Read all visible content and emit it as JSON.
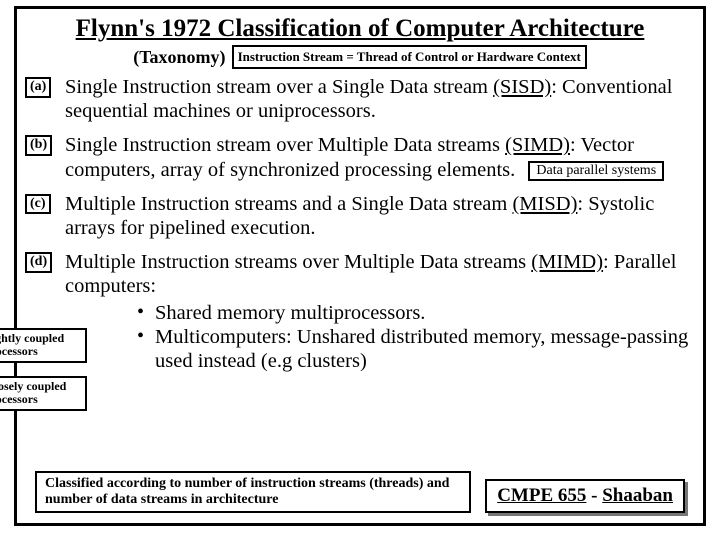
{
  "title": "Flynn's 1972 Classification of Computer Architecture",
  "taxonomy": "(Taxonomy)",
  "instruction_note": "Instruction Stream = Thread of Control or Hardware Context",
  "items": {
    "a": {
      "tag": "(a)",
      "text_a": "Single Instruction stream over a Single Data stream ",
      "abbr": "(SISD)",
      "text_b": ": Conventional sequential machines or uniprocessors."
    },
    "b": {
      "tag": "(b)",
      "text_a": "Single Instruction stream over Multiple Data streams ",
      "abbr": "(SIMD)",
      "text_b": ":  Vector computers, array of synchronized processing elements.",
      "dps": "Data parallel systems"
    },
    "c": {
      "tag": "(c)",
      "text_a": "Multiple Instruction streams and a Single Data stream ",
      "abbr": "(MISD)",
      "text_b": ":  Systolic arrays for pipelined execution."
    },
    "d": {
      "tag": "(d)",
      "text_a": "Multiple Instruction streams over Multiple Data streams ",
      "abbr": "(MIMD)",
      "text_b": ":  Parallel computers:",
      "bullets": [
        "Shared memory multiprocessors.",
        "Multicomputers:  Unshared distributed memory, message-passing used instead (e.g clusters)"
      ]
    }
  },
  "sideboxes": {
    "tight": "Tightly coupled processors",
    "loose": "Loosely coupled processors"
  },
  "footer_note": "Classified according to number of instruction streams (threads) and number of data streams in architecture",
  "course": {
    "code": "CMPE 655",
    "sep": " - ",
    "author": "Shaaban"
  }
}
